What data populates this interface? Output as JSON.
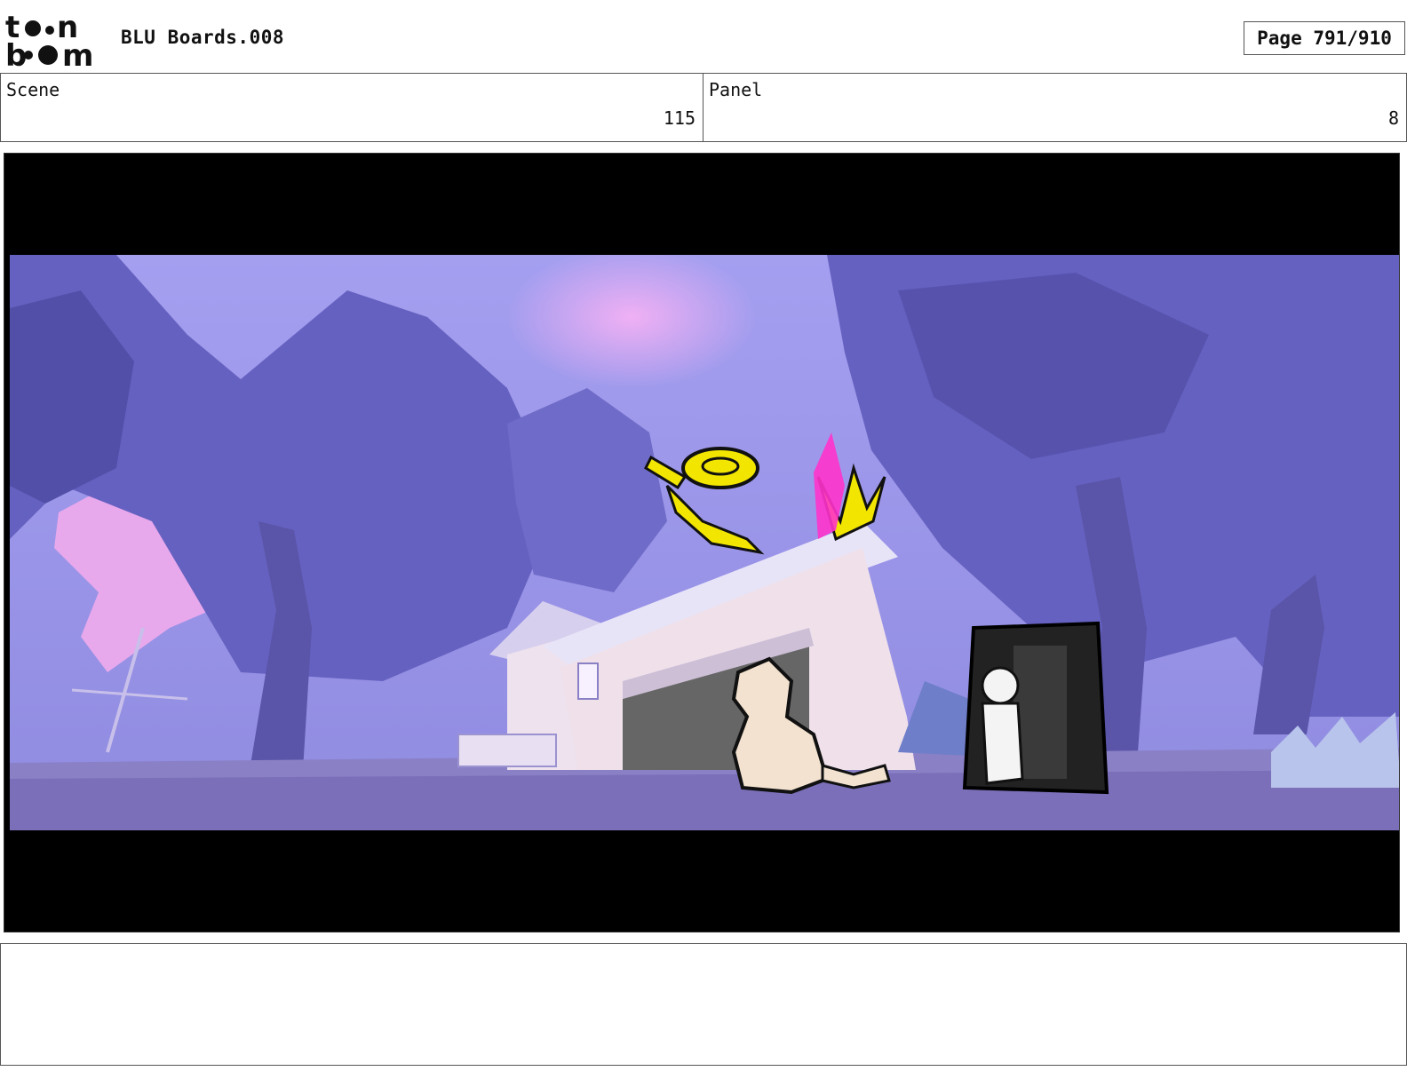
{
  "header": {
    "logo_text": "toon boom",
    "title": "BLU Boards.008",
    "page_label": "Page 791/910"
  },
  "info": {
    "scene_label": "Scene",
    "scene_value": "115",
    "panel_label": "Panel",
    "panel_value": "8"
  },
  "frame": {
    "letterbox_color": "#000000",
    "palette": {
      "sky": "#8f8be8",
      "sky_pink": "#e6a6f2",
      "foliage_dark": "#5a57b0",
      "foliage_mid": "#7b77cf",
      "ground": "#7a6fb8",
      "garage_door": "#666666",
      "flying_objects": "#f2e600",
      "magenta_splash": "#ff33cc",
      "creature": "#f3e2cf",
      "booth": "#222222"
    }
  },
  "notes": {
    "text": ""
  }
}
